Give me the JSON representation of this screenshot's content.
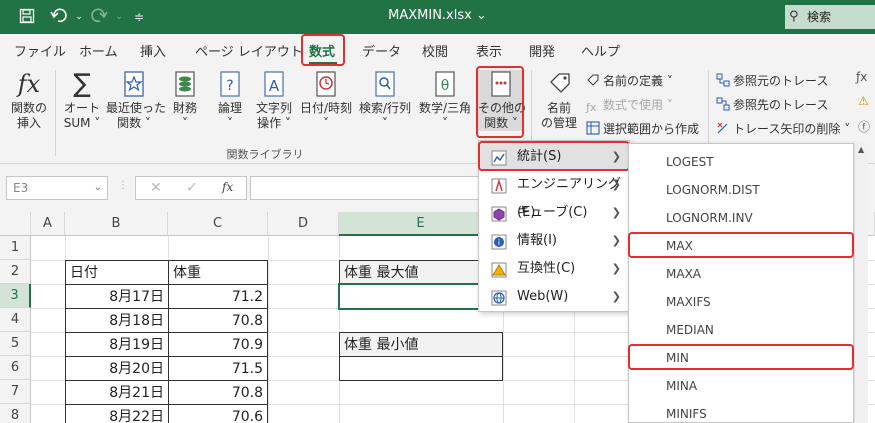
{
  "titlebar": {
    "filename": "MAXMIN.xlsx",
    "dropdown_caret": "⌄",
    "search_label": "検索"
  },
  "tabs": [
    {
      "label": "ファイル"
    },
    {
      "label": "ホーム"
    },
    {
      "label": "挿入"
    },
    {
      "label": "ページ レイアウト"
    },
    {
      "label": "数式",
      "active": true
    },
    {
      "label": "データ"
    },
    {
      "label": "校閲"
    },
    {
      "label": "表示"
    },
    {
      "label": "開発"
    },
    {
      "label": "ヘルプ"
    }
  ],
  "ribbon": {
    "insert_function": [
      "関数の",
      "挿入"
    ],
    "autosum": [
      "オート",
      "SUM ˅"
    ],
    "recent": [
      "最近使った",
      "関数 ˅"
    ],
    "financial": [
      "財務",
      "˅"
    ],
    "logical": [
      "論理",
      "˅"
    ],
    "text": [
      "文字列",
      "操作 ˅"
    ],
    "datetime": [
      "日付/時刻",
      "˅"
    ],
    "lookup": [
      "検索/行列",
      "˅"
    ],
    "math": [
      "数学/三角",
      "˅"
    ],
    "more": [
      "その他の",
      "関数 ˅"
    ],
    "name_manager": [
      "名前",
      "の管理"
    ],
    "define_name": "名前の定義 ˅",
    "use_in_formula": "数式で使用 ˅",
    "create_from_selection": "選択範囲から作成",
    "trace_precedents": "参照元のトレース",
    "trace_dependents": "参照先のトレース",
    "remove_arrows": "トレース矢印の削除 ˅",
    "group_label": "関数ライブラリ"
  },
  "formula_bar": {
    "name_box": "E3",
    "fx": "fx",
    "cancel": "✕",
    "enter": "✓",
    "value": ""
  },
  "columns": [
    "A",
    "B",
    "C",
    "D",
    "E"
  ],
  "rows": [
    "1",
    "2",
    "3",
    "4",
    "5",
    "6",
    "7",
    "8"
  ],
  "sheet": {
    "b2": "日付",
    "c2": "体重",
    "dates": [
      "8月17日",
      "8月18日",
      "8月19日",
      "8月20日",
      "8月21日",
      "8月22日"
    ],
    "weights": [
      "71.2",
      "70.8",
      "70.9",
      "71.5",
      "70.8",
      "70.6"
    ],
    "e2": "体重 最大値",
    "e5": "体重 最小値"
  },
  "menu_more": [
    {
      "label": "統計(S)",
      "accel": "S",
      "hover": true
    },
    {
      "label": "エンジニアリング(E)",
      "accel": "E"
    },
    {
      "label": "キューブ(C)",
      "accel": "C"
    },
    {
      "label": "情報(I)",
      "accel": "I"
    },
    {
      "label": "互換性(C)",
      "accel": "C"
    },
    {
      "label": "Web(W)",
      "accel": "W"
    }
  ],
  "menu_statistical": [
    "LOGEST",
    "LOGNORM.DIST",
    "LOGNORM.INV",
    "MAX",
    "MAXA",
    "MAXIFS",
    "MEDIAN",
    "MIN",
    "MINA",
    "MINIFS"
  ],
  "colors": {
    "accent": "#217346",
    "highlight": "#e03030"
  }
}
